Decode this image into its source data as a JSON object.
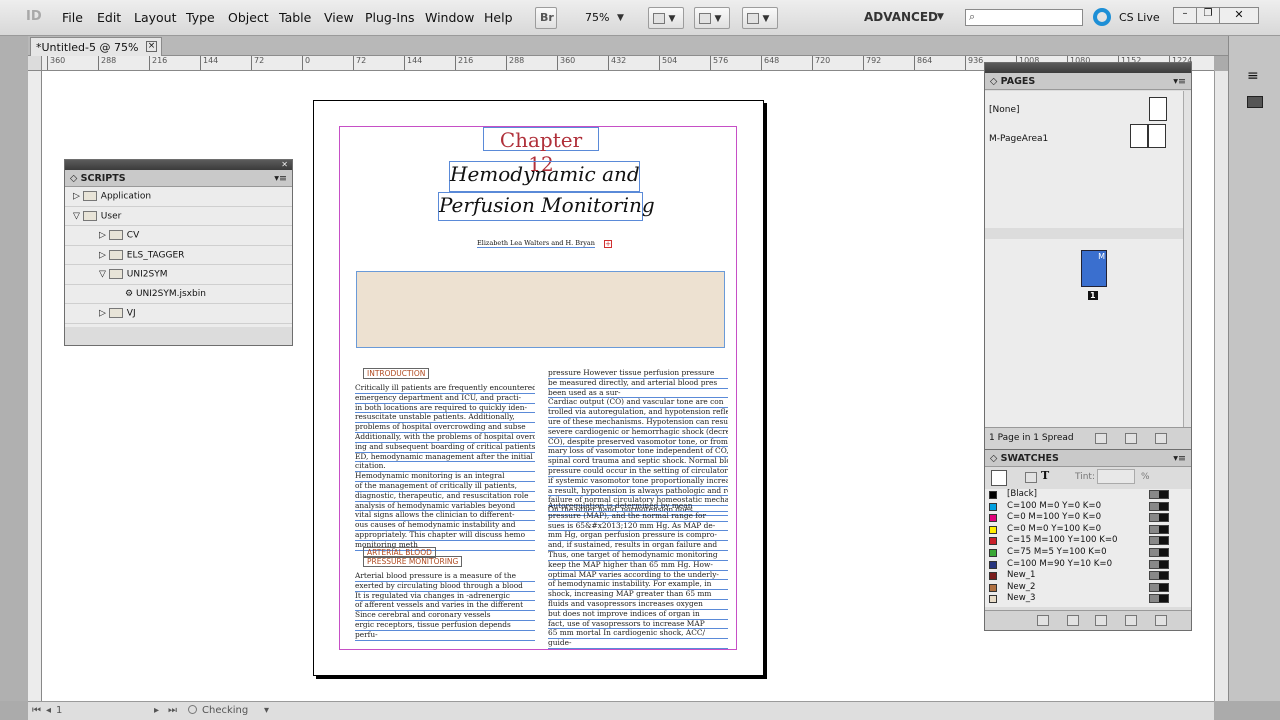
{
  "menubar": {
    "logo": "ID",
    "items": [
      "File",
      "Edit",
      "Layout",
      "Type",
      "Object",
      "Table",
      "View",
      "Plug-Ins",
      "Window",
      "Help"
    ],
    "bridge_label": "Br",
    "zoom_value": "75%",
    "workspace": "ADVANCED",
    "search_placeholder": "",
    "cslive": "CS Live"
  },
  "document_tab": {
    "title": "*Untitled-5 @ 75%",
    "close": "×"
  },
  "ruler": {
    "labels": [
      "360",
      "288",
      "216",
      "144",
      "72",
      "0",
      "72",
      "144",
      "216",
      "288",
      "360",
      "432",
      "504",
      "576",
      "648",
      "720",
      "792",
      "864",
      "936",
      "1008",
      "1080",
      "1152",
      "1224"
    ]
  },
  "page": {
    "chapter": "Chapter 12",
    "title_line1": "Hemodynamic and",
    "title_line2": "Perfusion Monitoring",
    "authors": "Elizabeth Lea Walters and H. Bryan",
    "heading_intro": "INTRODUCTION",
    "heading_abp_1": "ARTERIAL BLOOD",
    "heading_abp_2": "PRESSURE MONITORING",
    "col1": [
      "Critically ill patients are frequently encountered in the",
      "emergency department and ICU, and practi-",
      "in both locations are required to quickly iden-",
      "resuscitate unstable patients. Additionally,",
      "problems of hospital overcrowding and subse",
      "Additionally, with the problems of hospital overcrowd",
      "ing and subsequent boarding of critical patients in the",
      "ED, hemodynamic management after the initial resus",
      "citation.",
      "Hemodynamic monitoring is an integral",
      "of the management of critically ill patients,",
      "diagnostic, therapeutic, and resuscitation role",
      "analysis of hemodynamic variables beyond",
      "vital signs allows the clinician to different-",
      "ous causes of hemodynamic instability and",
      "appropriately. This chapter will discuss hemo",
      "monitoring meth"
    ],
    "col1b": [
      "Arterial blood pressure is a measure of the",
      "exerted by circulating blood through a blood",
      "It is regulated via changes in    -adrenergic",
      "of afferent vessels and varies in the different",
      "Since cerebral and coronary vessels",
      "ergic receptors, tissue perfusion depends",
      "perfu-"
    ],
    "col2": [
      "pressure However tissue perfusion pressure",
      "be measured directly, and arterial blood pres",
      "been used as a sur-",
      "Cardiac output (CO) and vascular tone are con",
      "trolled via autoregulation, and hypotension reflects a",
      "ure of these mechanisms. Hypotension can result from",
      "severe cardiogenic or hemorrhagic shock (decreased",
      "CO), despite preserved vasomotor tone, or from a pri",
      "mary loss of vasomotor tone independent of CO, as in",
      "spinal cord trauma and septic shock. Normal blood",
      "pressure could occur in the setting of circulatory shock",
      "if systemic vasomotor tone proportionally increases. As",
      "a result, hypotension is always pathologic and reflects a",
      "failure of normal circulatory homeostatic mechanisms.",
      "On the other hand, normotension does"
    ],
    "col2b": [
      "Autoregulation is determined by mean",
      "pressure (MAP), and the normal range for",
      "sues is 65&#x2013;120 mm Hg. As MAP de-",
      "mm Hg, organ perfusion pressure is compro-",
      "and, if sustained, results in organ failure and",
      "Thus, one target of hemodynamic monitoring",
      "keep the MAP higher than 65 mm Hg. How-",
      "optimal MAP varies according to the underly-",
      "of hemodynamic instability. For example, in",
      "shock, increasing MAP greater than 65 mm",
      "fluids and vasopressors increases oxygen",
      "but does not improve indices of organ      in",
      "fact, use of vasopressors to increase MAP",
      "65 mm mortal    In cardiogenic shock, ACC/",
      "guide-"
    ]
  },
  "scripts_panel": {
    "title": "SCRIPTS",
    "items": [
      {
        "label": "Application",
        "indent": 0,
        "expanded": false
      },
      {
        "label": "User",
        "indent": 0,
        "expanded": true
      },
      {
        "label": "CV",
        "indent": 1,
        "expanded": false
      },
      {
        "label": "ELS_TAGGER",
        "indent": 1,
        "expanded": false
      },
      {
        "label": "UNI2SYM",
        "indent": 1,
        "expanded": true
      },
      {
        "label": "UNI2SYM.jsxbin",
        "indent": 2,
        "expanded": false
      },
      {
        "label": "VJ",
        "indent": 1,
        "expanded": false
      }
    ]
  },
  "pages_panel": {
    "title": "PAGES",
    "none_label": "[None]",
    "master_label": "M-PageArea1",
    "page_number": "1",
    "master_letter": "M",
    "footer": "1 Page in 1 Spread"
  },
  "swatches_panel": {
    "title": "SWATCHES",
    "tint_label": "Tint:",
    "tint_value": "",
    "percent": "%",
    "swatches": [
      {
        "name": "[Black]",
        "color": "#000000"
      },
      {
        "name": "C=100 M=0 Y=0 K=0",
        "color": "#00a0e0"
      },
      {
        "name": "C=0 M=100 Y=0 K=0",
        "color": "#e0007a"
      },
      {
        "name": "C=0 M=0 Y=100 K=0",
        "color": "#ffee00"
      },
      {
        "name": "C=15 M=100 Y=100 K=0",
        "color": "#c8202a"
      },
      {
        "name": "C=75 M=5 Y=100 K=0",
        "color": "#3aa836"
      },
      {
        "name": "C=100 M=90 Y=10 K=0",
        "color": "#27357f"
      },
      {
        "name": "New_1",
        "color": "#7a1c1c"
      },
      {
        "name": "New_2",
        "color": "#b07040"
      },
      {
        "name": "New_3",
        "color": "#e8dcc8"
      }
    ]
  },
  "status": {
    "page": "1",
    "checking": "Checking"
  }
}
